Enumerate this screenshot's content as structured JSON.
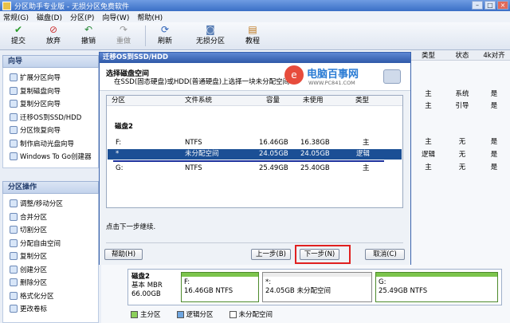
{
  "window": {
    "title": "分区助手专业版 - 无损分区免费软件"
  },
  "menubar": [
    "常规(G)",
    "磁盘(D)",
    "分区(P)",
    "向导(W)",
    "帮助(H)"
  ],
  "toolbar": {
    "buttons": [
      "提交",
      "放弃",
      "撤销",
      "重做",
      "刷新",
      "无损分区",
      "教程"
    ]
  },
  "wizard_section": {
    "title": "向导",
    "items": [
      "扩展分区向导",
      "复制磁盘向导",
      "复制分区向导",
      "迁移OS到SSD/HDD",
      "分区恢复向导",
      "制作启动光盘向导",
      "Windows To Go创建器"
    ]
  },
  "partition_ops_section": {
    "title": "分区操作",
    "items": [
      "调整/移动分区",
      "合并分区",
      "切割分区",
      "分配自由空间",
      "复制分区",
      "创建分区",
      "删除分区",
      "格式化分区",
      "更改卷标"
    ]
  },
  "bg_table": {
    "headers": [
      "类型",
      "状态",
      "4k对齐"
    ],
    "rows": [
      [
        "主",
        "系统",
        "是"
      ],
      [
        "主",
        "引导",
        "是"
      ],
      [
        "主",
        "无",
        "是"
      ],
      [
        "逻辑",
        "无",
        "是"
      ],
      [
        "主",
        "无",
        "是"
      ]
    ]
  },
  "dialog": {
    "title": "迁移OS到SSD/HDD",
    "heading": "选择磁盘空间",
    "description": "在SSD(固态硬盘)或HDD(普通硬盘)上选择一块未分配空间",
    "logo": {
      "title": "电脑百事网",
      "url": "WWW.PC841.COM"
    },
    "columns": [
      "分区",
      "文件系统",
      "容量",
      "未使用",
      "类型"
    ],
    "disk_label": "磁盘2",
    "rows": [
      {
        "part": "F:",
        "fs": "NTFS",
        "cap": "16.46GB",
        "free": "16.38GB",
        "type": "主"
      },
      {
        "part": "*",
        "fs": "未分配空间",
        "cap": "24.05GB",
        "free": "24.05GB",
        "type": "逻辑"
      },
      {
        "part": "G:",
        "fs": "NTFS",
        "cap": "25.49GB",
        "free": "25.40GB",
        "type": "主"
      }
    ],
    "hint": "点击下一步继续.",
    "buttons": {
      "help": "帮助(H)",
      "back": "上一步(B)",
      "next": "下一步(N)",
      "cancel": "取消(C)"
    }
  },
  "diskmap": {
    "disk_name": "磁盘2",
    "disk_info": "基本 MBR",
    "disk_size": "66.00GB",
    "p1_label": "F:",
    "p1_info": "16.46GB NTFS",
    "p2_label": "*:",
    "p2_info": "24.05GB 未分配空间",
    "p3_label": "G:",
    "p3_info": "25.49GB NTFS"
  },
  "legend": [
    "主分区",
    "逻辑分区",
    "未分配空间"
  ],
  "colors": {
    "selection": "#1b4f95",
    "underline": "#1a2f9c",
    "highlight_box": "#e02020",
    "primary": "#8ccf5c",
    "unallocated": "#ffffff"
  }
}
